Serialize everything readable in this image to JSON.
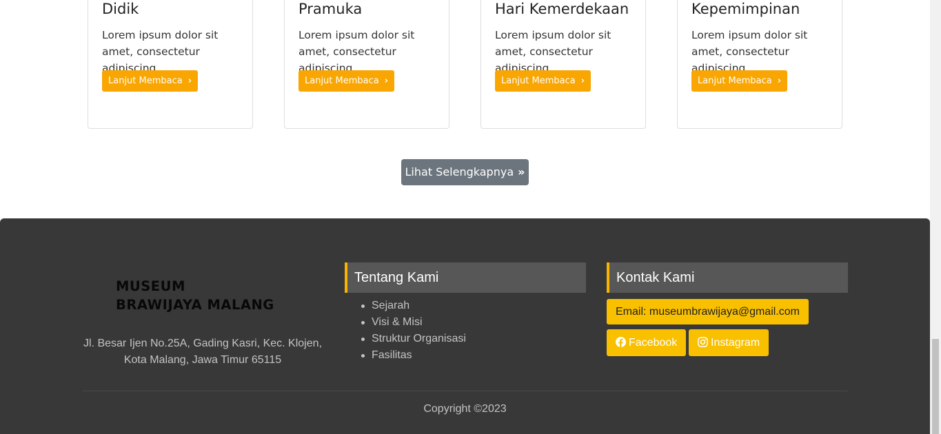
{
  "cards": [
    {
      "title": "Didik",
      "text": "Lorem ipsum dolor sit amet, consectetur adipiscing...",
      "button": "Lanjut Membaca"
    },
    {
      "title": "Pramuka",
      "text": "Lorem ipsum dolor sit amet, consectetur adipiscing...",
      "button": "Lanjut Membaca"
    },
    {
      "title": "Hari Kemerdekaan",
      "text": "Lorem ipsum dolor sit amet, consectetur adipiscing...",
      "button": "Lanjut Membaca"
    },
    {
      "title": "Kepemimpinan",
      "text": "Lorem ipsum dolor sit amet, consectetur adipiscing...",
      "button": "Lanjut Membaca"
    }
  ],
  "more_button": "Lihat Selengkapnya",
  "footer": {
    "logo_line1": "MUSEUM",
    "logo_line2": "BRAWIJAYA MALANG",
    "address": "Jl. Besar Ijen No.25A, Gading Kasri, Kec. Klojen, Kota Malang, Jawa Timur 65115",
    "about": {
      "title": "Tentang Kami",
      "links": [
        "Sejarah",
        "Visi & Misi",
        "Struktur Organisasi",
        "Fasilitas"
      ]
    },
    "contact": {
      "title": "Kontak Kami",
      "email": "Email: museumbrawijaya@gmail.com",
      "facebook": "Facebook",
      "instagram": "Instagram"
    },
    "copyright": "Copyright ©2023"
  },
  "colors": {
    "accent": "#f9a602",
    "contact_button": "#f9c000",
    "footer_bg": "#383838",
    "more_button_bg": "#6c757d"
  },
  "icons": [
    "chevron-right-icon",
    "double-chevron-right-icon",
    "facebook-icon",
    "instagram-icon"
  ]
}
